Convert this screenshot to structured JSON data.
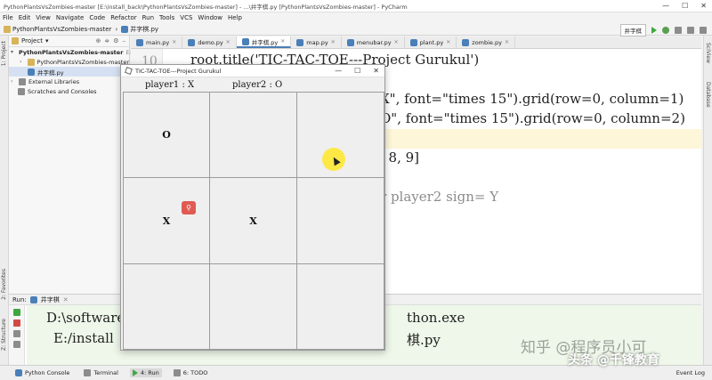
{
  "window": {
    "title": "PythonPlantsVsZombies-master [E:\\install_back\\PythonPlantsVsZombies-master] - ...\\井字棋.py [PythonPlantsVsZombies-master] - PyCharm",
    "controls": [
      "—",
      "☐",
      "✕"
    ]
  },
  "menu": {
    "items": [
      "File",
      "Edit",
      "View",
      "Navigate",
      "Code",
      "Refactor",
      "Run",
      "Tools",
      "VCS",
      "Window",
      "Help"
    ]
  },
  "navbar": {
    "project": "PythonPlantsVsZombies-master",
    "file": "井字棋.py",
    "run_config": "井字棋"
  },
  "project_panel": {
    "title": "Project",
    "tree": [
      {
        "label": "PythonPlantsVsZombies-master",
        "suffix": "E:\\",
        "expanded": true
      },
      {
        "label": "PythonPlantsVsZombies-master",
        "expanded": false
      },
      {
        "label": "井字棋.py"
      },
      {
        "label": "External Libraries",
        "expanded": false
      },
      {
        "label": "Scratches and Consoles"
      }
    ]
  },
  "tabs": [
    {
      "label": "main.py"
    },
    {
      "label": "demo.py"
    },
    {
      "label": "井字棋.py",
      "active": true
    },
    {
      "label": "map.py"
    },
    {
      "label": "menubar.py"
    },
    {
      "label": "plant.py"
    },
    {
      "label": "zombie.py"
    }
  ],
  "editor": {
    "line_number": "10",
    "lines": [
      "root.title('TIC-TAC-TOE---Project Gurukul')",
      "X\", font=\"times 15\").grid(row=0, column=1)",
      "O\", font=\"times 15\").grid(row=0, column=2)",
      ", 8, 9]",
      "r player2 sign= Y"
    ]
  },
  "run_panel": {
    "tab": "井字棋",
    "label": "Run:",
    "console": [
      "D:\\software",
      "thon.exe",
      "E:/install",
      "棋.py"
    ]
  },
  "left_stripe": [
    "1: Project",
    "2: Favorites",
    "Z: Structure"
  ],
  "right_stripe": [
    "SciView",
    "Database"
  ],
  "bottom": {
    "buttons": [
      "Python Console",
      "Terminal",
      "4: Run",
      "6: TODO"
    ],
    "event_log": "Event Log"
  },
  "tk_window": {
    "title": "TIC-TAC-TOE---Project Gurukul",
    "player1": "player1 : X",
    "player2": "player2 : O",
    "cells": [
      "O",
      "",
      "",
      "X",
      "X",
      "",
      "",
      "",
      ""
    ]
  },
  "watermark": {
    "line1": "知乎 @程序员小可",
    "line2": "头条 @千锋教育"
  }
}
